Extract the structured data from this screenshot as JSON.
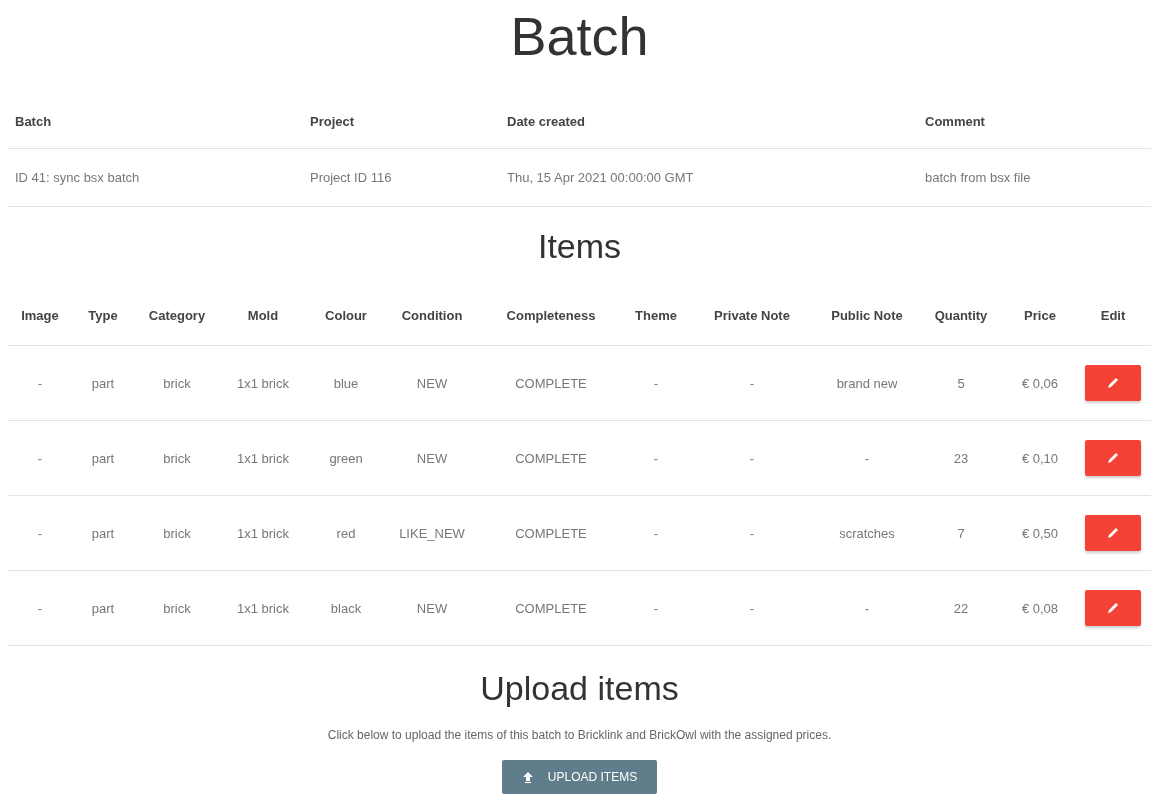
{
  "title": "Batch",
  "batch_table": {
    "columns": [
      "Batch",
      "Project",
      "Date created",
      "Comment"
    ],
    "rows": [
      [
        "ID 41: sync bsx batch",
        "Project ID 116",
        "Thu, 15 Apr 2021 00:00:00 GMT",
        "batch from bsx file"
      ]
    ]
  },
  "items_heading": "Items",
  "items_table": {
    "columns": [
      "Image",
      "Type",
      "Category",
      "Mold",
      "Colour",
      "Condition",
      "Completeness",
      "Theme",
      "Private Note",
      "Public Note",
      "Quantity",
      "Price",
      "Edit"
    ],
    "rows": [
      [
        "-",
        "part",
        "brick",
        "1x1 brick",
        "blue",
        "NEW",
        "COMPLETE",
        "-",
        "-",
        "brand new",
        "5",
        "€ 0,06"
      ],
      [
        "-",
        "part",
        "brick",
        "1x1 brick",
        "green",
        "NEW",
        "COMPLETE",
        "-",
        "-",
        "-",
        "23",
        "€ 0,10"
      ],
      [
        "-",
        "part",
        "brick",
        "1x1 brick",
        "red",
        "LIKE_NEW",
        "COMPLETE",
        "-",
        "-",
        "scratches",
        "7",
        "€ 0,50"
      ],
      [
        "-",
        "part",
        "brick",
        "1x1 brick",
        "black",
        "NEW",
        "COMPLETE",
        "-",
        "-",
        "-",
        "22",
        "€ 0,08"
      ]
    ]
  },
  "upload": {
    "heading": "Upload items",
    "text": "Click below to upload the items of this batch to Bricklink and BrickOwl with the assigned prices.",
    "button": "UPLOAD ITEMS"
  }
}
